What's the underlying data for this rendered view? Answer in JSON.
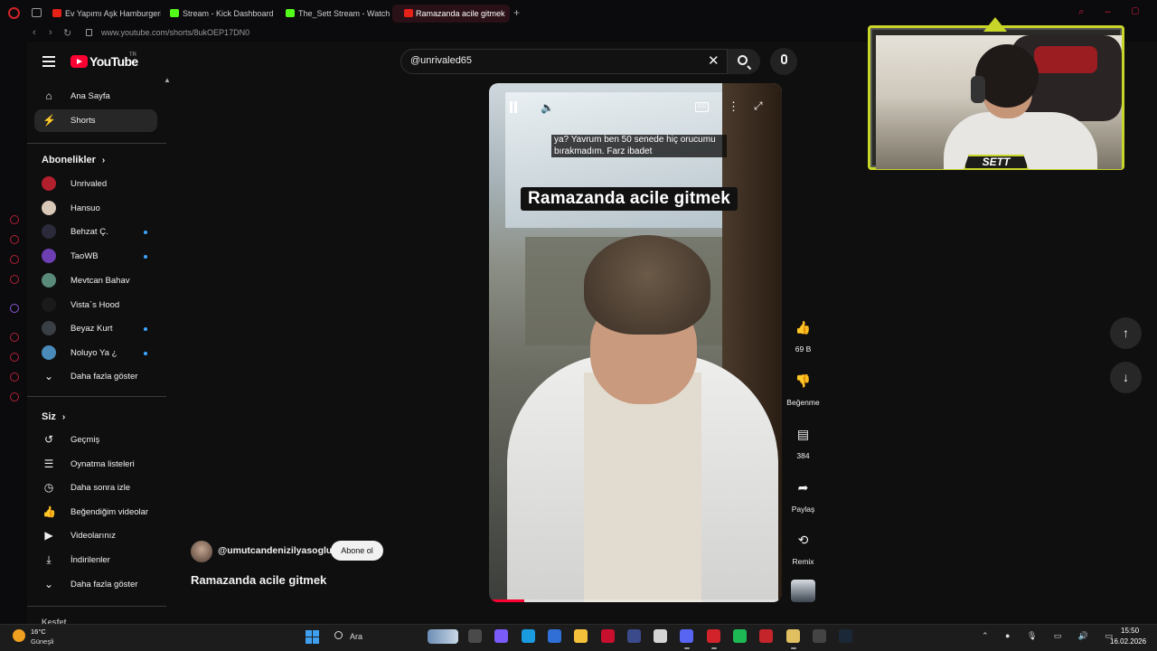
{
  "browser": {
    "tabs": [
      {
        "label": "Ev Yapımı Aşk Hamburgeri",
        "favicon_color": "#e62117",
        "active": false
      },
      {
        "label": "Stream - Kick Dashboard",
        "favicon_color": "#53fc18",
        "active": false
      },
      {
        "label": "The_Sett Stream - Watch Live",
        "favicon_color": "#53fc18",
        "active": false
      },
      {
        "label": "Ramazanda acile gitmek",
        "favicon_color": "#e62117",
        "active": true
      }
    ],
    "url": "www.youtube.com/shorts/8ukOEP17DN0"
  },
  "youtube": {
    "logo_text": "YouTube",
    "region": "TR",
    "search": {
      "value": "@unrivaled65"
    }
  },
  "sidebar": {
    "main": [
      {
        "label": "Ana Sayfa",
        "icon": "home-icon",
        "glyph": "⌂",
        "selected": false
      },
      {
        "label": "Shorts",
        "icon": "shorts-icon",
        "glyph": "⚡",
        "selected": true
      }
    ],
    "subscriptions_title": "Abonelikler",
    "subscriptions": [
      {
        "label": "Unrivaled",
        "color": "#b21f2d",
        "new": false
      },
      {
        "label": "Hansuo",
        "color": "#d8c8b8",
        "new": false
      },
      {
        "label": "Behzat Ç.",
        "color": "#2a2a3a",
        "new": true
      },
      {
        "label": "TaoWB",
        "color": "#6d3fb2",
        "new": true
      },
      {
        "label": "Mevtcan Bahav",
        "color": "#5a8a7a",
        "new": false
      },
      {
        "label": "Vista`s Hood",
        "color": "#1a1a1a",
        "new": false
      },
      {
        "label": "Beyaz Kurt",
        "color": "#3a3f45",
        "new": true
      },
      {
        "label": "Noluyo Ya ¿",
        "color": "#4a8ab8",
        "new": true
      }
    ],
    "subscriptions_more": "Daha fazla göster",
    "you_title": "Siz",
    "you": [
      {
        "label": "Geçmiş",
        "icon": "history-icon",
        "glyph": "↺"
      },
      {
        "label": "Oynatma listeleri",
        "icon": "playlists-icon",
        "glyph": "☰"
      },
      {
        "label": "Daha sonra izle",
        "icon": "watch-later-icon",
        "glyph": "◷"
      },
      {
        "label": "Beğendiğim videolar",
        "icon": "liked-videos-icon",
        "glyph": "👍"
      },
      {
        "label": "Videolarınız",
        "icon": "your-videos-icon",
        "glyph": "▶"
      },
      {
        "label": "İndirilenler",
        "icon": "downloads-icon",
        "glyph": "⤓"
      }
    ],
    "you_more": "Daha fazla göster",
    "explore_title": "Keşfet"
  },
  "player": {
    "caption_line1": "ya? Yavrum ben 50 senede hiç orucumu",
    "caption_line2": "bırakmadım. Farz ibadet",
    "overlay_title": "Ramazanda acile gitmek",
    "progress": 0.12
  },
  "actions": {
    "likes": "69 B",
    "dislike": "Beğenme",
    "comments": "384",
    "share": "Paylaş",
    "remix": "Remix"
  },
  "channel": {
    "handle": "@umutcandenizilyasoglu",
    "subscribe": "Abone ol",
    "title": "Ramazanda acile gitmek"
  },
  "webcam": {
    "name": "SETT"
  },
  "taskbar": {
    "weather_temp": "16°C",
    "weather_desc": "Güneşli",
    "search_label": "Ara",
    "apps": [
      {
        "icon": "task-view-icon",
        "color": "#4a4a4a"
      },
      {
        "icon": "copilot-icon",
        "color": "#7a5af8"
      },
      {
        "icon": "edge-icon",
        "color": "#1a9be0"
      },
      {
        "icon": "store-icon",
        "color": "#2f6fd6"
      },
      {
        "icon": "file-explorer-icon",
        "color": "#f3c13a"
      },
      {
        "icon": "mcafee-icon",
        "color": "#c8102e"
      },
      {
        "icon": "vpn-icon",
        "color": "#3a4a8a"
      },
      {
        "icon": "app-icon",
        "color": "#d4d4d4"
      },
      {
        "icon": "discord-icon",
        "color": "#5865f2"
      },
      {
        "icon": "opera-icon",
        "color": "#d2232a"
      },
      {
        "icon": "spotify-icon",
        "color": "#1db954"
      },
      {
        "icon": "record-icon",
        "color": "#c4252a"
      },
      {
        "icon": "notes-icon",
        "color": "#e0c060"
      },
      {
        "icon": "obs-icon",
        "color": "#444444"
      },
      {
        "icon": "steam-icon",
        "color": "#1b2838"
      }
    ],
    "time": "15:50",
    "date": "16.02.2026"
  }
}
